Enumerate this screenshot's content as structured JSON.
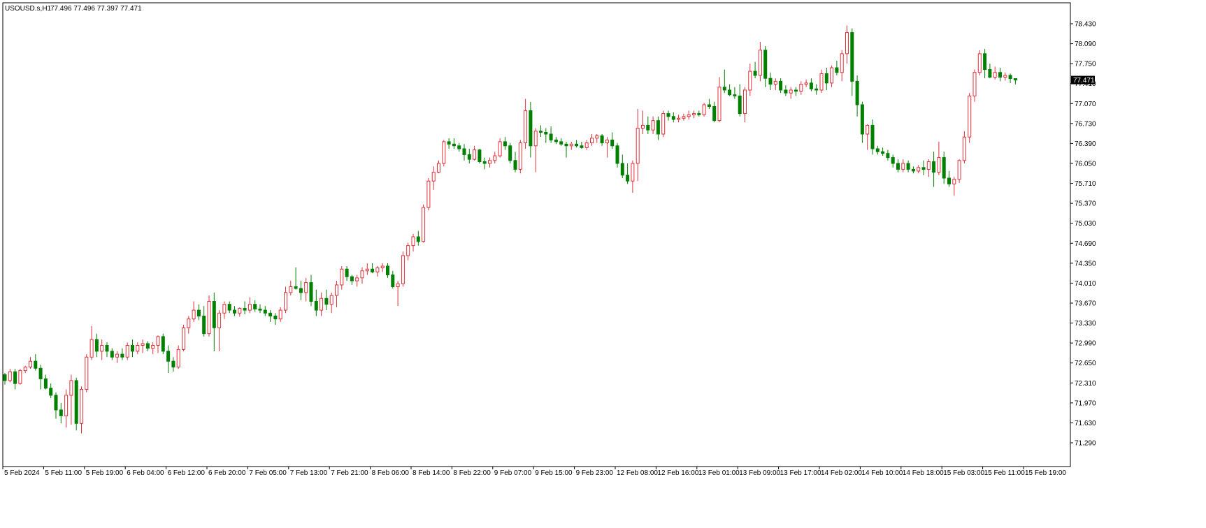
{
  "header": {
    "symbol_timeframe": "USOUSD.s,H1",
    "ohlc_text": "77.496 77.496 77.397 77.471"
  },
  "colors": {
    "background": "#ffffff",
    "frame": "#000000",
    "bull_body": "#ffffff",
    "bull_outline": "#e0303a",
    "bear_body": "#008000",
    "bear_outline": "#008000",
    "price_tag_bg": "#000000",
    "price_tag_text": "#ffffff"
  },
  "chart_data": {
    "type": "candlestick",
    "title": "USOUSD.s,H1",
    "xlabel": "",
    "ylabel": "",
    "ylim": [
      71.29,
      78.6
    ],
    "grid": false,
    "price_ticks": [
      "78.430",
      "78.090",
      "77.750",
      "77.410",
      "77.070",
      "76.730",
      "76.390",
      "76.050",
      "75.710",
      "75.370",
      "75.030",
      "74.690",
      "74.350",
      "74.010",
      "73.670",
      "73.330",
      "72.990",
      "72.650",
      "72.310",
      "71.970",
      "71.630",
      "71.290"
    ],
    "price_tick_values": [
      78.43,
      78.09,
      77.75,
      77.41,
      77.07,
      76.73,
      76.39,
      76.05,
      75.71,
      75.37,
      75.03,
      74.69,
      74.35,
      74.01,
      73.67,
      73.33,
      72.99,
      72.65,
      72.31,
      71.97,
      71.63,
      71.29
    ],
    "current_price": "77.471",
    "current_price_value": 77.471,
    "time_labels": [
      "5 Feb 2024",
      "5 Feb 11:00",
      "5 Feb 19:00",
      "6 Feb 04:00",
      "6 Feb 12:00",
      "6 Feb 20:00",
      "7 Feb 05:00",
      "7 Feb 13:00",
      "7 Feb 21:00",
      "8 Feb 06:00",
      "8 Feb 14:00",
      "8 Feb 22:00",
      "9 Feb 07:00",
      "9 Feb 15:00",
      "9 Feb 23:00",
      "12 Feb 08:00",
      "12 Feb 16:00",
      "13 Feb 01:00",
      "13 Feb 09:00",
      "13 Feb 17:00",
      "14 Feb 02:00",
      "14 Feb 10:00",
      "14 Feb 18:00",
      "15 Feb 03:00",
      "15 Feb 11:00",
      "15 Feb 19:00"
    ],
    "time_label_bar_index": [
      0,
      8,
      16,
      24,
      32,
      40,
      48,
      56,
      64,
      72,
      80,
      88,
      96,
      104,
      112,
      120,
      128,
      136,
      144,
      152,
      160,
      168,
      176,
      184,
      192,
      200
    ],
    "candles": {
      "fields": [
        "open",
        "high",
        "low",
        "close"
      ],
      "values": [
        [
          72.45,
          72.48,
          72.28,
          72.35
        ],
        [
          72.35,
          72.55,
          72.32,
          72.5
        ],
        [
          72.5,
          72.55,
          72.2,
          72.3
        ],
        [
          72.3,
          72.55,
          72.28,
          72.52
        ],
        [
          72.52,
          72.6,
          72.48,
          72.58
        ],
        [
          72.58,
          72.75,
          72.55,
          72.68
        ],
        [
          72.68,
          72.8,
          72.52,
          72.56
        ],
        [
          72.56,
          72.62,
          72.2,
          72.38
        ],
        [
          72.38,
          72.45,
          72.2,
          72.22
        ],
        [
          72.22,
          72.3,
          72.05,
          72.1
        ],
        [
          72.1,
          72.15,
          71.7,
          71.85
        ],
        [
          71.85,
          71.97,
          71.62,
          71.75
        ],
        [
          71.75,
          72.2,
          71.55,
          72.1
        ],
        [
          72.1,
          72.45,
          71.6,
          72.35
        ],
        [
          72.35,
          72.4,
          71.5,
          71.62
        ],
        [
          71.62,
          72.25,
          71.45,
          72.2
        ],
        [
          72.2,
          72.8,
          72.15,
          72.75
        ],
        [
          72.75,
          73.28,
          72.7,
          73.05
        ],
        [
          73.05,
          73.15,
          72.75,
          72.85
        ],
        [
          72.85,
          73.05,
          72.7,
          72.95
        ],
        [
          72.95,
          73.0,
          72.75,
          72.85
        ],
        [
          72.85,
          72.9,
          72.7,
          72.75
        ],
        [
          72.75,
          72.85,
          72.65,
          72.8
        ],
        [
          72.8,
          72.9,
          72.7,
          72.75
        ],
        [
          72.75,
          73.0,
          72.7,
          72.95
        ],
        [
          72.95,
          73.05,
          72.75,
          72.85
        ],
        [
          72.85,
          73.0,
          72.8,
          72.95
        ],
        [
          72.95,
          73.05,
          72.82,
          72.98
        ],
        [
          72.98,
          73.02,
          72.85,
          72.9
        ],
        [
          72.9,
          73.0,
          72.8,
          72.95
        ],
        [
          72.95,
          73.12,
          72.82,
          73.1
        ],
        [
          73.1,
          73.15,
          72.8,
          72.85
        ],
        [
          72.85,
          72.95,
          72.48,
          72.68
        ],
        [
          72.68,
          72.75,
          72.5,
          72.58
        ],
        [
          72.58,
          72.95,
          72.55,
          72.88
        ],
        [
          72.88,
          73.3,
          72.85,
          73.25
        ],
        [
          73.25,
          73.45,
          73.15,
          73.4
        ],
        [
          73.4,
          73.7,
          73.35,
          73.55
        ],
        [
          73.55,
          73.65,
          73.38,
          73.45
        ],
        [
          73.45,
          73.62,
          73.1,
          73.15
        ],
        [
          73.15,
          73.8,
          73.1,
          73.7
        ],
        [
          73.7,
          73.85,
          72.85,
          73.25
        ],
        [
          73.25,
          73.55,
          72.85,
          73.5
        ],
        [
          73.5,
          73.7,
          73.4,
          73.65
        ],
        [
          73.65,
          73.7,
          73.5,
          73.55
        ],
        [
          73.55,
          73.62,
          73.45,
          73.5
        ],
        [
          73.5,
          73.6,
          73.44,
          73.58
        ],
        [
          73.58,
          73.7,
          73.48,
          73.55
        ],
        [
          73.55,
          73.77,
          73.5,
          73.65
        ],
        [
          73.65,
          73.72,
          73.52,
          73.57
        ],
        [
          73.57,
          73.65,
          73.5,
          73.55
        ],
        [
          73.55,
          73.62,
          73.45,
          73.5
        ],
        [
          73.5,
          73.55,
          73.35,
          73.45
        ],
        [
          73.45,
          73.5,
          73.3,
          73.4
        ],
        [
          73.4,
          73.6,
          73.35,
          73.55
        ],
        [
          73.55,
          73.95,
          73.5,
          73.85
        ],
        [
          73.85,
          74.05,
          73.8,
          73.95
        ],
        [
          73.95,
          74.28,
          73.9,
          73.92
        ],
        [
          73.92,
          74.05,
          73.72,
          73.85
        ],
        [
          73.85,
          74.1,
          73.7,
          74.02
        ],
        [
          74.02,
          74.15,
          73.62,
          73.7
        ],
        [
          73.7,
          73.9,
          73.45,
          73.55
        ],
        [
          73.55,
          73.85,
          73.45,
          73.75
        ],
        [
          73.75,
          73.9,
          73.55,
          73.65
        ],
        [
          73.65,
          73.85,
          73.5,
          73.8
        ],
        [
          73.8,
          74.05,
          73.6,
          73.98
        ],
        [
          73.98,
          74.3,
          73.9,
          74.25
        ],
        [
          74.25,
          74.3,
          74.05,
          74.12
        ],
        [
          74.12,
          74.15,
          73.98,
          74.05
        ],
        [
          74.05,
          74.15,
          73.95,
          74.1
        ],
        [
          74.1,
          74.28,
          74.0,
          74.22
        ],
        [
          74.22,
          74.35,
          74.15,
          74.25
        ],
        [
          74.25,
          74.35,
          74.18,
          74.2
        ],
        [
          74.2,
          74.3,
          74.12,
          74.27
        ],
        [
          74.27,
          74.35,
          74.2,
          74.3
        ],
        [
          74.3,
          74.35,
          74.1,
          74.15
        ],
        [
          74.15,
          74.22,
          73.92,
          73.95
        ],
        [
          73.95,
          74.05,
          73.62,
          74.0
        ],
        [
          74.0,
          74.55,
          73.95,
          74.48
        ],
        [
          74.48,
          74.7,
          74.4,
          74.65
        ],
        [
          74.65,
          74.85,
          74.55,
          74.8
        ],
        [
          74.8,
          74.9,
          74.65,
          74.72
        ],
        [
          74.72,
          75.35,
          74.7,
          75.3
        ],
        [
          75.3,
          75.8,
          75.25,
          75.75
        ],
        [
          75.75,
          76.0,
          75.6,
          75.9
        ],
        [
          75.9,
          76.1,
          75.88,
          76.05
        ],
        [
          76.05,
          76.45,
          76.0,
          76.42
        ],
        [
          76.42,
          76.48,
          76.3,
          76.38
        ],
        [
          76.38,
          76.48,
          76.3,
          76.35
        ],
        [
          76.35,
          76.4,
          76.25,
          76.3
        ],
        [
          76.3,
          76.38,
          76.1,
          76.2
        ],
        [
          76.2,
          76.3,
          76.05,
          76.12
        ],
        [
          76.12,
          76.35,
          76.1,
          76.28
        ],
        [
          76.28,
          76.3,
          76.05,
          76.08
        ],
        [
          76.08,
          76.15,
          75.95,
          76.05
        ],
        [
          76.05,
          76.15,
          75.98,
          76.1
        ],
        [
          76.1,
          76.25,
          76.05,
          76.18
        ],
        [
          76.18,
          76.48,
          76.15,
          76.42
        ],
        [
          76.42,
          76.5,
          76.28,
          76.35
        ],
        [
          76.35,
          76.4,
          76.05,
          76.1
        ],
        [
          76.1,
          76.25,
          75.9,
          75.95
        ],
        [
          75.95,
          76.45,
          75.88,
          76.4
        ],
        [
          76.4,
          77.15,
          76.3,
          76.95
        ],
        [
          76.95,
          77.1,
          76.15,
          76.35
        ],
        [
          76.35,
          76.65,
          75.9,
          76.6
        ],
        [
          76.6,
          76.7,
          76.5,
          76.58
        ],
        [
          76.58,
          76.65,
          76.4,
          76.55
        ],
        [
          76.55,
          76.68,
          76.4,
          76.45
        ],
        [
          76.45,
          76.5,
          76.38,
          76.42
        ],
        [
          76.42,
          76.48,
          76.35,
          76.38
        ],
        [
          76.38,
          76.42,
          76.15,
          76.35
        ],
        [
          76.35,
          76.42,
          76.28,
          76.38
        ],
        [
          76.38,
          76.45,
          76.32,
          76.35
        ],
        [
          76.35,
          76.42,
          76.3,
          76.32
        ],
        [
          76.32,
          76.45,
          76.28,
          76.4
        ],
        [
          76.4,
          76.55,
          76.35,
          76.48
        ],
        [
          76.48,
          76.55,
          76.4,
          76.52
        ],
        [
          76.52,
          76.55,
          76.35,
          76.4
        ],
        [
          76.4,
          76.5,
          76.15,
          76.45
        ],
        [
          76.45,
          76.58,
          76.3,
          76.35
        ],
        [
          76.35,
          76.4,
          75.98,
          76.05
        ],
        [
          76.05,
          76.2,
          75.8,
          75.85
        ],
        [
          75.85,
          76.05,
          75.7,
          75.75
        ],
        [
          75.75,
          76.1,
          75.55,
          76.05
        ],
        [
          76.05,
          76.98,
          75.75,
          76.65
        ],
        [
          76.65,
          76.95,
          76.55,
          76.7
        ],
        [
          76.7,
          76.85,
          76.55,
          76.62
        ],
        [
          76.62,
          76.85,
          76.55,
          76.78
        ],
        [
          76.78,
          76.85,
          76.45,
          76.55
        ],
        [
          76.55,
          76.95,
          76.5,
          76.9
        ],
        [
          76.9,
          76.95,
          76.78,
          76.85
        ],
        [
          76.85,
          76.92,
          76.75,
          76.8
        ],
        [
          76.8,
          76.88,
          76.75,
          76.82
        ],
        [
          76.82,
          76.9,
          76.78,
          76.85
        ],
        [
          76.85,
          76.95,
          76.8,
          76.88
        ],
        [
          76.88,
          76.95,
          76.82,
          76.9
        ],
        [
          76.9,
          76.95,
          76.85,
          76.88
        ],
        [
          76.88,
          77.08,
          76.85,
          77.05
        ],
        [
          77.05,
          77.15,
          76.98,
          77.02
        ],
        [
          77.02,
          77.1,
          76.75,
          76.78
        ],
        [
          76.78,
          77.52,
          76.75,
          77.35
        ],
        [
          77.35,
          77.65,
          77.25,
          77.3
        ],
        [
          77.3,
          77.4,
          77.2,
          77.22
        ],
        [
          77.22,
          77.35,
          77.15,
          77.2
        ],
        [
          77.2,
          77.4,
          76.85,
          76.9
        ],
        [
          76.9,
          77.35,
          76.75,
          77.3
        ],
        [
          77.3,
          77.75,
          77.2,
          77.62
        ],
        [
          77.62,
          77.78,
          77.5,
          77.55
        ],
        [
          77.55,
          78.12,
          77.45,
          77.98
        ],
        [
          77.98,
          78.05,
          77.35,
          77.5
        ],
        [
          77.5,
          77.6,
          77.3,
          77.4
        ],
        [
          77.4,
          77.5,
          77.3,
          77.45
        ],
        [
          77.45,
          77.5,
          77.25,
          77.3
        ],
        [
          77.3,
          77.38,
          77.2,
          77.25
        ],
        [
          77.25,
          77.35,
          77.15,
          77.3
        ],
        [
          77.3,
          77.35,
          77.2,
          77.28
        ],
        [
          77.28,
          77.45,
          77.22,
          77.4
        ],
        [
          77.4,
          77.48,
          77.35,
          77.42
        ],
        [
          77.42,
          77.5,
          77.28,
          77.32
        ],
        [
          77.32,
          77.4,
          77.22,
          77.3
        ],
        [
          77.3,
          77.65,
          77.25,
          77.58
        ],
        [
          77.58,
          77.68,
          77.3,
          77.42
        ],
        [
          77.42,
          77.72,
          77.35,
          77.68
        ],
        [
          77.68,
          77.8,
          77.55,
          77.6
        ],
        [
          77.6,
          77.98,
          77.45,
          77.92
        ],
        [
          77.92,
          78.4,
          77.75,
          78.28
        ],
        [
          78.28,
          78.35,
          77.2,
          77.45
        ],
        [
          77.45,
          77.55,
          76.85,
          77.05
        ],
        [
          77.05,
          77.1,
          76.4,
          76.55
        ],
        [
          76.55,
          76.72,
          76.28,
          76.7
        ],
        [
          76.7,
          76.8,
          76.2,
          76.3
        ],
        [
          76.3,
          76.35,
          76.2,
          76.25
        ],
        [
          76.25,
          76.32,
          76.18,
          76.22
        ],
        [
          76.22,
          76.28,
          76.1,
          76.15
        ],
        [
          76.15,
          76.2,
          75.98,
          76.05
        ],
        [
          76.05,
          76.12,
          75.9,
          75.95
        ],
        [
          75.95,
          76.12,
          75.9,
          76.05
        ],
        [
          76.05,
          76.1,
          75.9,
          75.95
        ],
        [
          75.95,
          76.0,
          75.88,
          75.92
        ],
        [
          75.92,
          76.02,
          75.88,
          75.98
        ],
        [
          75.98,
          76.1,
          75.85,
          75.95
        ],
        [
          75.95,
          76.12,
          75.82,
          76.08
        ],
        [
          76.08,
          76.25,
          75.65,
          75.9
        ],
        [
          75.9,
          76.42,
          75.85,
          76.15
        ],
        [
          76.15,
          76.25,
          75.7,
          75.8
        ],
        [
          75.8,
          75.92,
          75.65,
          75.7
        ],
        [
          75.7,
          75.82,
          75.5,
          75.78
        ],
        [
          75.78,
          76.12,
          75.72,
          76.1
        ],
        [
          76.1,
          76.6,
          76.05,
          76.5
        ],
        [
          76.5,
          77.25,
          76.4,
          77.2
        ],
        [
          77.2,
          77.65,
          77.1,
          77.6
        ],
        [
          77.6,
          77.98,
          77.55,
          77.92
        ],
        [
          77.92,
          78.0,
          77.5,
          77.65
        ],
        [
          77.65,
          77.75,
          77.5,
          77.52
        ],
        [
          77.52,
          77.7,
          77.48,
          77.6
        ],
        [
          77.6,
          77.68,
          77.45,
          77.52
        ],
        [
          77.52,
          77.6,
          77.46,
          77.55
        ],
        [
          77.55,
          77.58,
          77.42,
          77.496
        ],
        [
          77.496,
          77.496,
          77.397,
          77.471
        ]
      ]
    }
  }
}
